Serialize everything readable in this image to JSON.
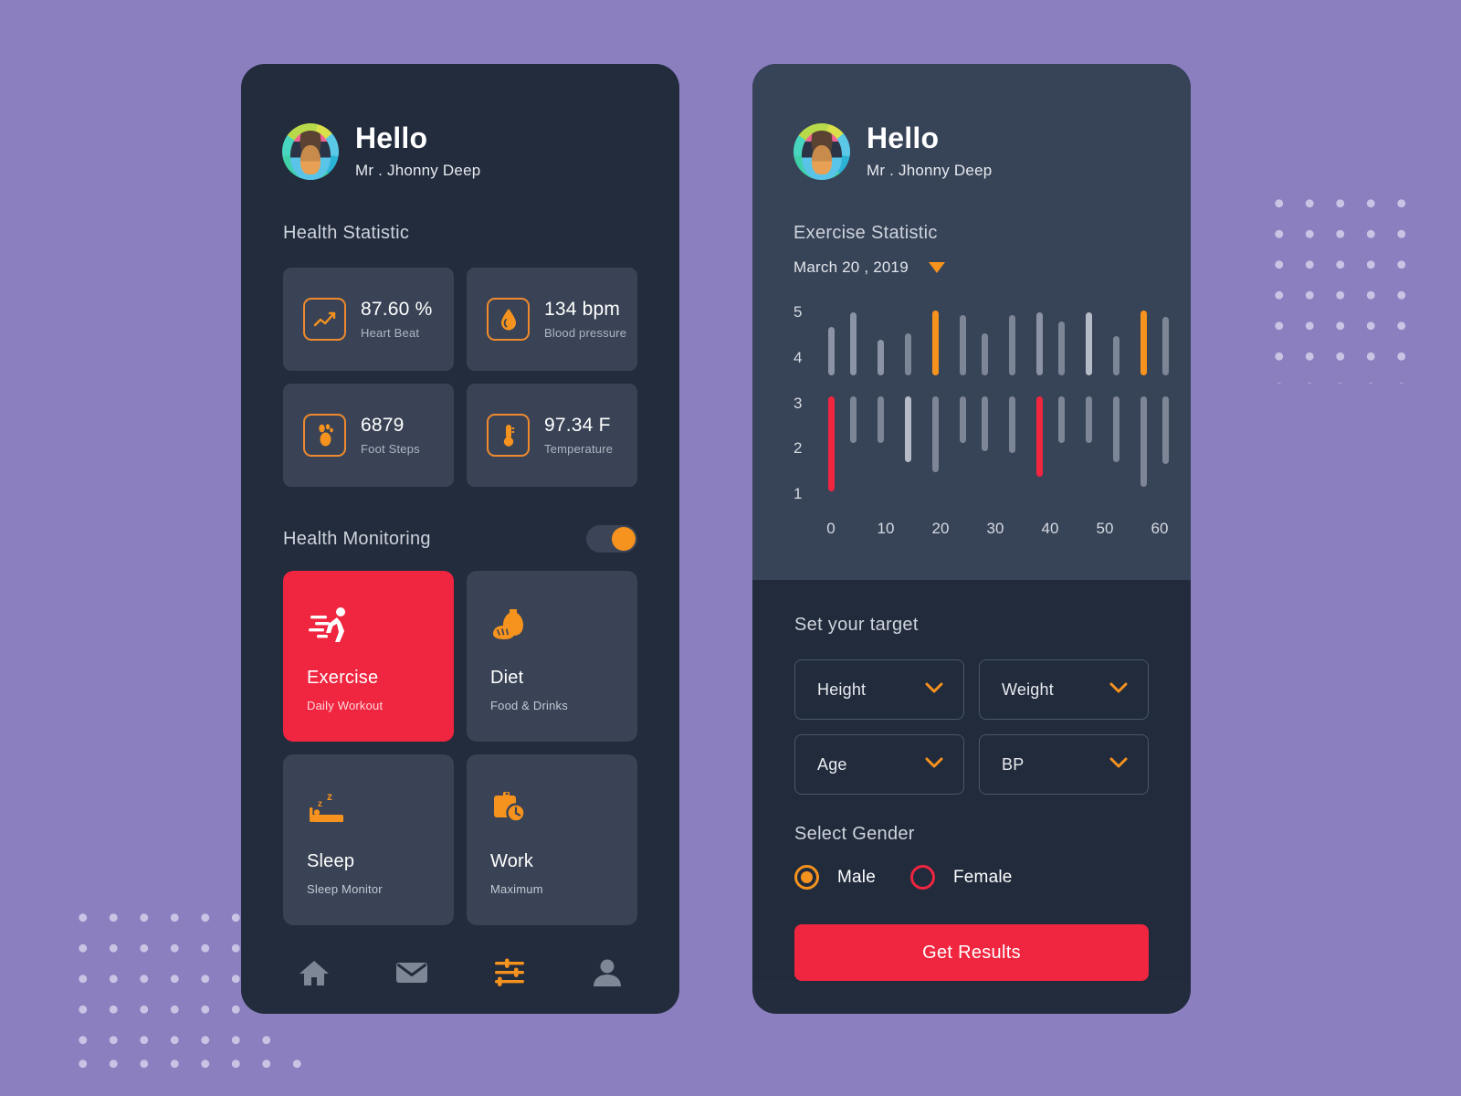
{
  "theme": {
    "page_bg": "#8b7fc0",
    "dot_color": "#c9c4e4",
    "phone_bg": "#222c3d",
    "card_bg": "#394355",
    "chart_panel_bg": "#374357",
    "target_panel_bg": "#212b3c",
    "accent_orange": "#f6921e",
    "accent_red": "#f0253f",
    "text_primary": "#ffffff",
    "text_muted": "#aeb5c2"
  },
  "left_phone": {
    "header": {
      "greeting": "Hello",
      "username": "Mr . Jhonny Deep",
      "avatar_name": "user-avatar"
    },
    "health_statistic": {
      "title": "Health Statistic",
      "cards": [
        {
          "icon": "heartbeat-line-icon",
          "value": "87.60 %",
          "label": "Heart Beat"
        },
        {
          "icon": "blood-drop-icon",
          "value": "134 bpm",
          "label": "Blood pressure"
        },
        {
          "icon": "footprint-icon",
          "value": "6879",
          "label": "Foot Steps"
        },
        {
          "icon": "thermometer-icon",
          "value": "97.34 F",
          "label": "Temperature"
        }
      ]
    },
    "health_monitoring": {
      "title": "Health Monitoring",
      "toggle_state": "on",
      "cards": [
        {
          "icon": "running-man-icon",
          "name": "Exercise",
          "sub": "Daily Workout",
          "active": true
        },
        {
          "icon": "bread-jar-icon",
          "name": "Diet",
          "sub": "Food & Drinks",
          "active": false
        },
        {
          "icon": "sleeping-bed-icon",
          "name": "Sleep",
          "sub": "Sleep Monitor",
          "active": false
        },
        {
          "icon": "briefcase-clock-icon",
          "name": "Work",
          "sub": "Maximum",
          "active": false
        }
      ]
    },
    "navbar": [
      {
        "icon": "home-icon",
        "active": false
      },
      {
        "icon": "mail-icon",
        "active": false
      },
      {
        "icon": "sliders-icon",
        "active": true
      },
      {
        "icon": "person-icon",
        "active": false
      }
    ]
  },
  "right_phone": {
    "header": {
      "greeting": "Hello",
      "username": "Mr . Jhonny Deep"
    },
    "exercise_statistic": {
      "title": "Exercise Statistic",
      "date": "March 20 , 2019",
      "date_caret": "caret-down-icon"
    },
    "set_target": {
      "title": "Set your target",
      "dropdowns": [
        {
          "label": "Height",
          "icon": "chevron-down-icon"
        },
        {
          "label": "Weight",
          "icon": "chevron-down-icon"
        },
        {
          "label": "Age",
          "icon": "chevron-down-icon"
        },
        {
          "label": "BP",
          "icon": "chevron-down-icon"
        }
      ],
      "gender_title": "Select Gender",
      "genders": [
        {
          "label": "Male",
          "selected": true,
          "color": "#f6921e"
        },
        {
          "label": "Female",
          "selected": false,
          "color": "#f0253f"
        }
      ],
      "cta_label": "Get Results"
    }
  },
  "chart_data": {
    "type": "bar",
    "title": "Exercise Statistic",
    "subtitle": "March 20 , 2019",
    "xlabel": "",
    "ylabel": "",
    "grid": false,
    "legend": false,
    "xlim": [
      0,
      63
    ],
    "ylim": [
      0.6,
      5.3
    ],
    "yticks": [
      5,
      4,
      3,
      2,
      1
    ],
    "xticks": [
      0,
      10,
      20,
      30,
      40,
      50,
      60
    ],
    "note": "Each x position has an upper segment (spanning high values) and a lower segment (spanning low values); each segment is drawn as a rounded vertical line from y_start to y_end.",
    "segments": [
      {
        "x": 0,
        "group": "upper",
        "y_start": 3.6,
        "y_end": 4.75,
        "color": "#8a94a6"
      },
      {
        "x": 0,
        "group": "lower",
        "y_start": 0.85,
        "y_end": 3.1,
        "color": "#f0253f"
      },
      {
        "x": 4,
        "group": "upper",
        "y_start": 3.6,
        "y_end": 5.1,
        "color": "#8a94a6"
      },
      {
        "x": 4,
        "group": "lower",
        "y_start": 2.0,
        "y_end": 3.1,
        "color": "#7d8697"
      },
      {
        "x": 9,
        "group": "upper",
        "y_start": 3.6,
        "y_end": 4.45,
        "color": "#8a94a6"
      },
      {
        "x": 9,
        "group": "lower",
        "y_start": 2.0,
        "y_end": 3.1,
        "color": "#7d8697"
      },
      {
        "x": 14,
        "group": "upper",
        "y_start": 3.6,
        "y_end": 4.6,
        "color": "#7d8697"
      },
      {
        "x": 14,
        "group": "lower",
        "y_start": 1.55,
        "y_end": 3.1,
        "color": "#b6bcc7"
      },
      {
        "x": 19,
        "group": "upper",
        "y_start": 3.6,
        "y_end": 5.15,
        "color": "#f6921e"
      },
      {
        "x": 19,
        "group": "lower",
        "y_start": 1.3,
        "y_end": 3.1,
        "color": "#7d8697"
      },
      {
        "x": 24,
        "group": "upper",
        "y_start": 3.6,
        "y_end": 5.05,
        "color": "#7d8697"
      },
      {
        "x": 24,
        "group": "lower",
        "y_start": 2.0,
        "y_end": 3.1,
        "color": "#7d8697"
      },
      {
        "x": 28,
        "group": "upper",
        "y_start": 3.6,
        "y_end": 4.6,
        "color": "#7d8697"
      },
      {
        "x": 28,
        "group": "lower",
        "y_start": 1.8,
        "y_end": 3.1,
        "color": "#7d8697"
      },
      {
        "x": 33,
        "group": "upper",
        "y_start": 3.6,
        "y_end": 5.05,
        "color": "#7d8697"
      },
      {
        "x": 33,
        "group": "lower",
        "y_start": 1.75,
        "y_end": 3.1,
        "color": "#7d8697"
      },
      {
        "x": 38,
        "group": "upper",
        "y_start": 3.6,
        "y_end": 5.1,
        "color": "#8a94a6"
      },
      {
        "x": 38,
        "group": "lower",
        "y_start": 1.2,
        "y_end": 3.1,
        "color": "#f0253f"
      },
      {
        "x": 42,
        "group": "upper",
        "y_start": 3.6,
        "y_end": 4.9,
        "color": "#7d8697"
      },
      {
        "x": 42,
        "group": "lower",
        "y_start": 2.0,
        "y_end": 3.1,
        "color": "#7d8697"
      },
      {
        "x": 47,
        "group": "upper",
        "y_start": 3.6,
        "y_end": 5.1,
        "color": "#b6bcc7"
      },
      {
        "x": 47,
        "group": "lower",
        "y_start": 2.0,
        "y_end": 3.1,
        "color": "#7d8697"
      },
      {
        "x": 52,
        "group": "upper",
        "y_start": 3.6,
        "y_end": 4.55,
        "color": "#7d8697"
      },
      {
        "x": 52,
        "group": "lower",
        "y_start": 1.55,
        "y_end": 3.1,
        "color": "#7d8697"
      },
      {
        "x": 57,
        "group": "upper",
        "y_start": 3.6,
        "y_end": 5.15,
        "color": "#f6921e"
      },
      {
        "x": 57,
        "group": "lower",
        "y_start": 0.95,
        "y_end": 3.1,
        "color": "#7d8697"
      },
      {
        "x": 61,
        "group": "upper",
        "y_start": 3.6,
        "y_end": 5.0,
        "color": "#7d8697"
      },
      {
        "x": 61,
        "group": "lower",
        "y_start": 1.5,
        "y_end": 3.1,
        "color": "#7d8697"
      }
    ]
  }
}
